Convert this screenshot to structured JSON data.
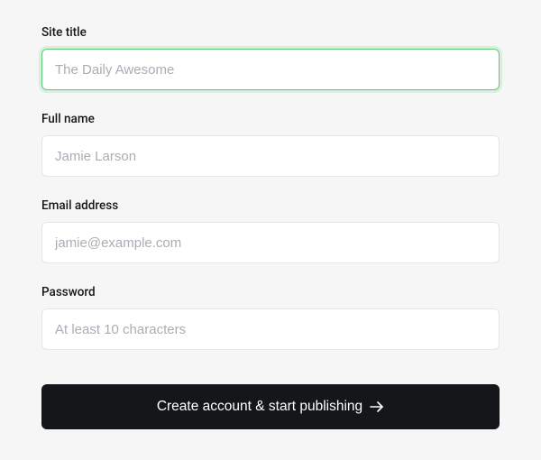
{
  "form": {
    "site_title": {
      "label": "Site title",
      "placeholder": "The Daily Awesome",
      "value": ""
    },
    "full_name": {
      "label": "Full name",
      "placeholder": "Jamie Larson",
      "value": ""
    },
    "email": {
      "label": "Email address",
      "placeholder": "jamie@example.com",
      "value": ""
    },
    "password": {
      "label": "Password",
      "placeholder": "At least 10 characters",
      "value": ""
    },
    "submit_label": "Create account & start publishing"
  }
}
